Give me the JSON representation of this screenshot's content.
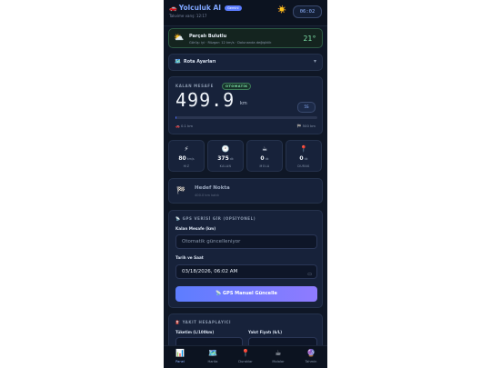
{
  "header": {
    "icon": "car-icon",
    "title": "Yolculuk AI",
    "badge": "Gemini",
    "subtitle": "Takvime varış: 12:17",
    "weather_icon": "sun-icon",
    "clock": "06:02"
  },
  "weather_card": {
    "icon": "partly-cloudy-icon",
    "title": "Parçalı Bulutlu",
    "detail": "Görüş: iyi · Rüzgar: 12 km/s · Dolunanda değişiklik",
    "temp": "21°"
  },
  "route_settings": {
    "icon": "map-icon",
    "label": "Rota Ayarları",
    "chevron": "▾"
  },
  "distance": {
    "label": "KALAN MESAFE",
    "mode_badge": "OTOMATİK",
    "value": "499.9",
    "unit": "km",
    "button_label": "5S",
    "progress": 0.001,
    "traveled": "0.1 km",
    "total": "500 km"
  },
  "stats": [
    {
      "icon": "lightning-icon",
      "glyph": "⚡",
      "value": "80",
      "unit": "km/s",
      "label": "HIZ"
    },
    {
      "icon": "clock-icon",
      "glyph": "🕐",
      "value": "375",
      "unit": "dk",
      "label": "KALAN"
    },
    {
      "icon": "coffee-icon",
      "glyph": "☕",
      "value": "0",
      "unit": "dk",
      "label": "MOLA"
    },
    {
      "icon": "pin-icon",
      "glyph": "📍",
      "value": "0",
      "unit": "dk",
      "label": "DURAK"
    }
  ],
  "destination": {
    "icon": "flag-icon",
    "title": "Hedef Nokta",
    "subtitle": "400.0 km kaldı"
  },
  "gps": {
    "header": "📡 GPS VERİSİ GİR (OPSİYONEL)",
    "distance_label": "Kalan Mesafe (km)",
    "distance_placeholder": "Otomatik güncelleniyor",
    "datetime_label": "Tarih ve Saat",
    "datetime_value": "03/18/2026, 06:02 AM",
    "button_label": "📡 GPS Manuel Güncelle"
  },
  "fuel": {
    "header": "⛽ YAKIT HESAPLAYICI",
    "consumption_label": "Tüketim (L/100km)",
    "price_label": "Yakıt Fiyatı (₺/L)"
  },
  "nav": [
    {
      "icon": "chart-icon",
      "glyph": "📊",
      "label": "Panel",
      "active": true
    },
    {
      "icon": "map-icon",
      "glyph": "🗺️",
      "label": "Harita",
      "active": false
    },
    {
      "icon": "pin-icon",
      "glyph": "📍",
      "label": "Duraklar",
      "active": false
    },
    {
      "icon": "coffee-icon",
      "glyph": "☕",
      "label": "Molalar",
      "active": false
    },
    {
      "icon": "crystal-ball-icon",
      "glyph": "🔮",
      "label": "Tahmin",
      "active": false
    }
  ]
}
